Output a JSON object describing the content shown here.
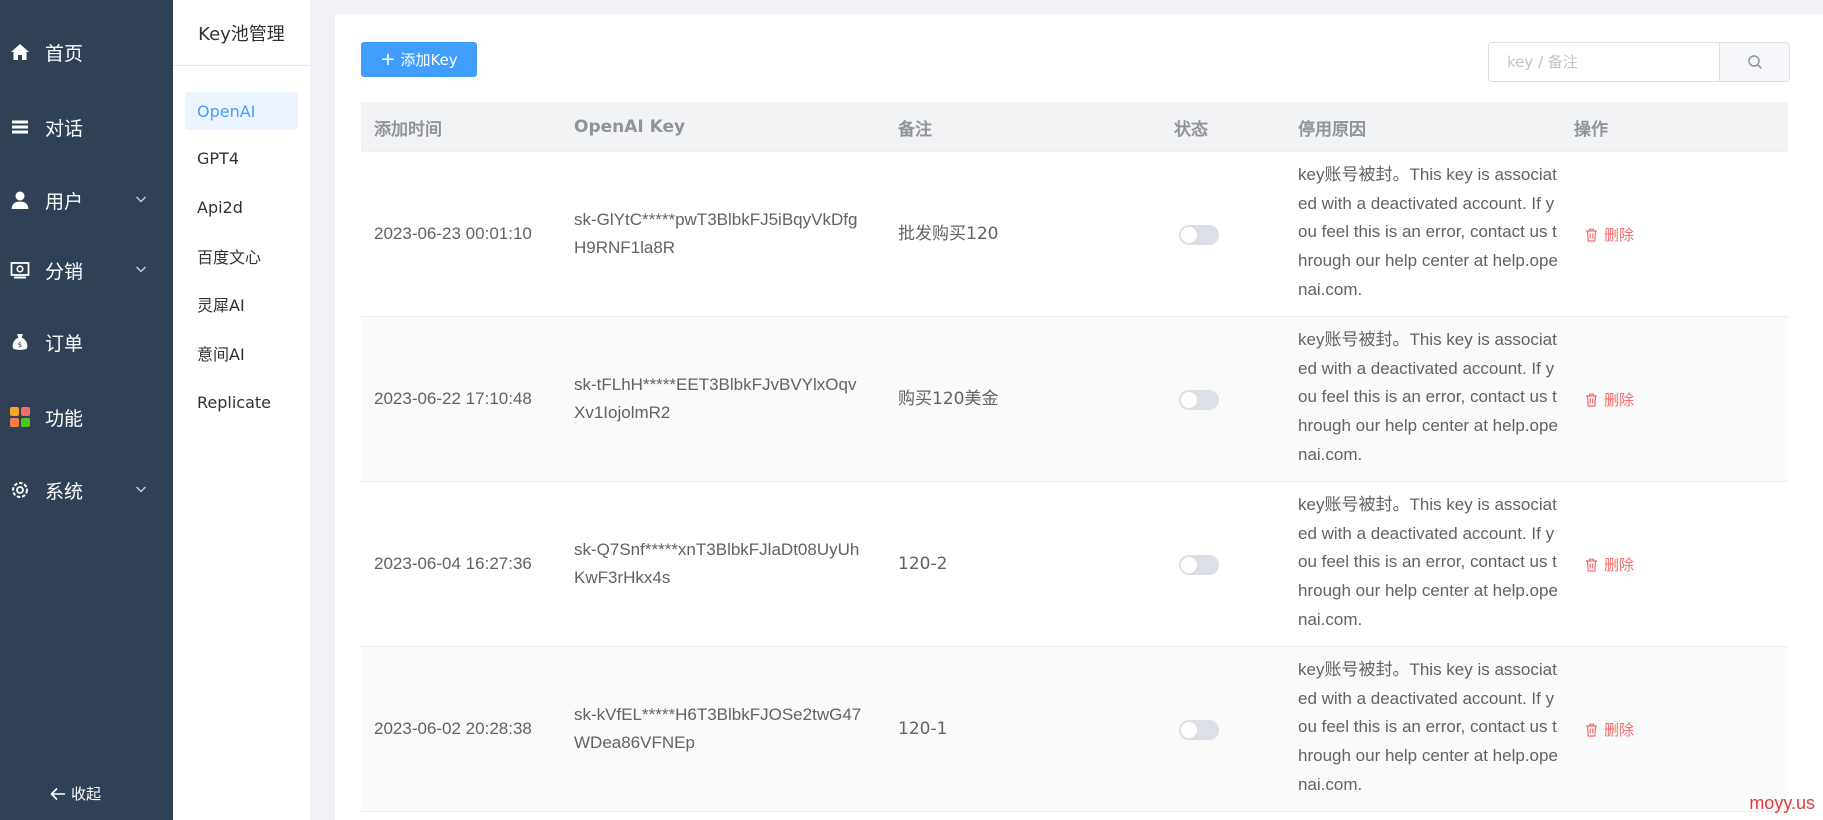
{
  "sidebar": {
    "items": [
      {
        "label": "首页",
        "icon": "home-icon",
        "has_chevron": false
      },
      {
        "label": "对话",
        "icon": "list-icon",
        "has_chevron": false
      },
      {
        "label": "用户",
        "icon": "user-icon",
        "has_chevron": true
      },
      {
        "label": "分销",
        "icon": "distribution-icon",
        "has_chevron": true
      },
      {
        "label": "订单",
        "icon": "money-bag-icon",
        "has_chevron": false
      },
      {
        "label": "功能",
        "icon": "apps-icon",
        "has_chevron": false
      },
      {
        "label": "系统",
        "icon": "gear-icon",
        "has_chevron": true
      }
    ],
    "collapse_label": "收起",
    "background": "#304156"
  },
  "subnav": {
    "title": "Key池管理",
    "items": [
      {
        "label": "OpenAI",
        "active": true
      },
      {
        "label": "GPT4",
        "active": false
      },
      {
        "label": "Api2d",
        "active": false
      },
      {
        "label": "百度文心",
        "active": false
      },
      {
        "label": "灵犀AI",
        "active": false
      },
      {
        "label": "意间AI",
        "active": false
      },
      {
        "label": "Replicate",
        "active": false
      }
    ]
  },
  "toolbar": {
    "add_label": "添加Key",
    "search_placeholder": "key / 备注"
  },
  "table": {
    "columns": [
      "添加时间",
      "OpenAI Key",
      "备注",
      "状态",
      "停用原因",
      "操作"
    ],
    "rows": [
      {
        "time": "2023-06-23 00:01:10",
        "key_line1": "sk-GlYtC*****pwT3BlbkFJ5iBqyVkDfg",
        "key_line2": "H9RNF1la8R",
        "note": "批发购买120",
        "status": false,
        "reason": "key账号被封。This key is associated with a deactivated account. If you feel this is an error, contact us through our help center at help.openai.com.",
        "action": "删除"
      },
      {
        "time": "2023-06-22 17:10:48",
        "key_line1": "sk-tFLhH*****EET3BlbkFJvBVYlxOqv",
        "key_line2": "Xv1IojolmR2",
        "note": "购买120美金",
        "status": false,
        "reason": "key账号被封。This key is associated with a deactivated account. If you feel this is an error, contact us through our help center at help.openai.com.",
        "action": "删除"
      },
      {
        "time": "2023-06-04 16:27:36",
        "key_line1": "sk-Q7Snf*****xnT3BlbkFJlaDt08UyUh",
        "key_line2": "KwF3rHkx4s",
        "note": "120-2",
        "status": false,
        "reason": "key账号被封。This key is associated with a deactivated account. If you feel this is an error, contact us through our help center at help.openai.com.",
        "action": "删除"
      },
      {
        "time": "2023-06-02 20:28:38",
        "key_line1": "sk-kVfEL*****H6T3BlbkFJOSe2twG47",
        "key_line2": "WDea86VFNEp",
        "note": "120-1",
        "status": false,
        "reason": "key账号被封。This key is associated with a deactivated account. If you feel this is an error, contact us through our help center at help.openai.com.",
        "action": "删除"
      }
    ]
  },
  "watermark": "moyy.us",
  "colors": {
    "primary": "#409eff",
    "danger": "#f56c6c",
    "sidebar_bg": "#304156"
  }
}
